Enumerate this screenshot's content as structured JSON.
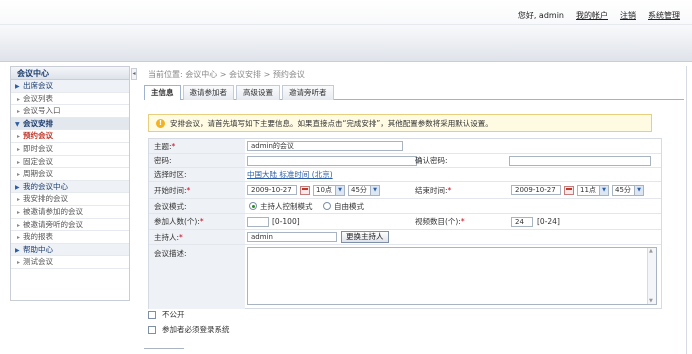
{
  "header": {
    "greeting": "您好, admin",
    "my_account": "我的帐户",
    "logout": "注销",
    "system_admin": "系统管理"
  },
  "sidebar": {
    "title": "会议中心",
    "rows": [
      {
        "type": "section",
        "label": "出席会议"
      },
      {
        "type": "item",
        "label": "会议列表"
      },
      {
        "type": "item",
        "label": "会议号入口"
      },
      {
        "type": "open",
        "label": "会议安排"
      },
      {
        "type": "active",
        "label": "预约会议"
      },
      {
        "type": "item",
        "label": "即时会议"
      },
      {
        "type": "item",
        "label": "固定会议"
      },
      {
        "type": "item",
        "label": "周期会议"
      },
      {
        "type": "section",
        "label": "我的会议中心"
      },
      {
        "type": "item",
        "label": "我安排的会议"
      },
      {
        "type": "item",
        "label": "被邀请参加的会议"
      },
      {
        "type": "item",
        "label": "被邀请旁听的会议"
      },
      {
        "type": "item",
        "label": "我的报表"
      },
      {
        "type": "section",
        "label": "帮助中心"
      },
      {
        "type": "item",
        "label": "测试会议"
      }
    ]
  },
  "breadcrumb": "当前位置: 会议中心 > 会议安排 > 预约会议",
  "tabs": [
    "主信息",
    "邀请参加者",
    "高级设置",
    "邀请旁听者"
  ],
  "tip": "安排会议，请首先填写如下主要信息。如果直接点击“完成安排”，其他配置参数将采用默认设置。",
  "form": {
    "topic_label": "主题:",
    "topic_value": "admin的会议",
    "password_label": "密码:",
    "password_value": "",
    "confirm_password_label": "确认密码:",
    "confirm_password_value": "",
    "timezone_label": "选择时区:",
    "timezone_value": "中国大陆 标准时间 (北京)",
    "start_label": "开始时间:",
    "start_date": "2009-10-27",
    "start_hour": "10点",
    "start_minute": "45分",
    "end_label": "结束时间:",
    "end_date": "2009-10-27",
    "end_hour": "11点",
    "end_minute": "45分",
    "mode_label": "会议模式:",
    "mode_option_1": "主持人控制模式",
    "mode_option_2": "自由模式",
    "attendees_label": "参加人数(个):",
    "attendees_value": "",
    "attendees_range": "[0-100]",
    "video_label": "视频数目(个):",
    "video_value": "24",
    "video_range": "[0-24]",
    "host_label": "主持人:",
    "host_value": "admin",
    "change_host_button": "更换主持人",
    "description_label": "会议描述:"
  },
  "checkboxes": {
    "not_public": "不公开",
    "must_login": "参加者必须登录系统"
  },
  "colors": {
    "required": "#d0021b",
    "link": "#2b5ea7",
    "active_nav": "#c0392b"
  }
}
